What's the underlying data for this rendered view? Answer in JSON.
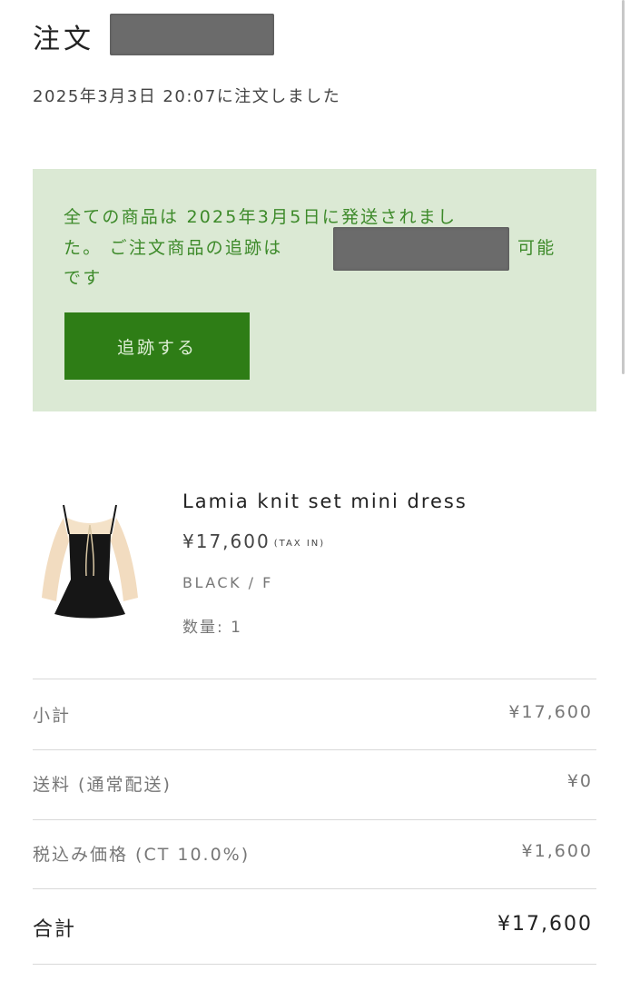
{
  "header": {
    "title": "注文",
    "order_datetime": "2025年3月3日 20:07に注文しました"
  },
  "shipping": {
    "line1": "全ての商品は 2025年3月5日に発送されまし",
    "line2_prefix": "た。 ご注文商品の追跡は",
    "line2_suffix": "可能",
    "line3": "です",
    "track_button_label": "追跡する"
  },
  "item": {
    "name": "Lamia knit set mini dress",
    "price": "¥17,600",
    "tax_note": "(TAX IN)",
    "variant": "BLACK / F",
    "quantity": "数量: 1"
  },
  "summary": {
    "subtotal_label": "小計",
    "subtotal_value": "¥17,600",
    "shipping_label": "送料 (通常配送)",
    "shipping_value": "¥0",
    "tax_label": "税込み価格 (CT 10.0%)",
    "tax_value": "¥1,600",
    "total_label": "合計",
    "total_value": "¥17,600"
  },
  "colors": {
    "banner_bg": "#dbe9d4",
    "banner_text": "#3d8a2a",
    "button_bg": "#2e7d16"
  }
}
